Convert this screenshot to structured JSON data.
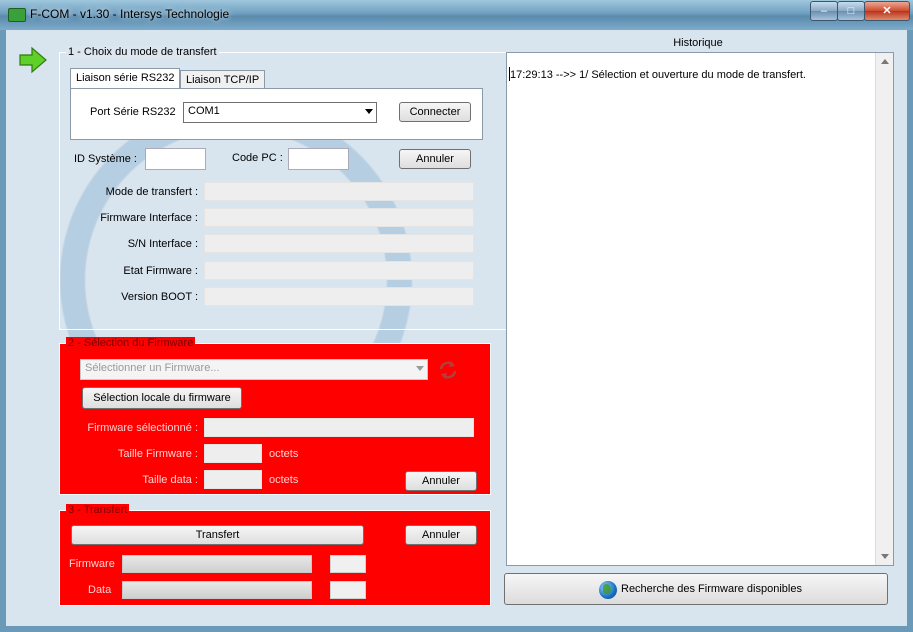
{
  "window": {
    "title": "F-COM - v1.30 - Intersys Technologie",
    "min_glyph": "–",
    "max_glyph": "□",
    "close_glyph": "✕"
  },
  "section1": {
    "legend": "1 - Choix du mode de transfert",
    "tabs": [
      {
        "label": "Liaison série RS232",
        "active": true
      },
      {
        "label": "Liaison TCP/IP",
        "active": false
      }
    ],
    "port_label": "Port Série RS232",
    "port_value": "COM1",
    "connect_button": "Connecter",
    "id_label": "ID Système :",
    "id_value": "",
    "code_label": "Code PC :",
    "code_value": "",
    "cancel_button": "Annuler",
    "fields": [
      {
        "label": "Mode de transfert :",
        "value": ""
      },
      {
        "label": "Firmware Interface :",
        "value": ""
      },
      {
        "label": "S/N Interface :",
        "value": ""
      },
      {
        "label": "Etat Firmware :",
        "value": ""
      },
      {
        "label": "Version BOOT :",
        "value": ""
      }
    ]
  },
  "section2": {
    "legend": "2 - Sélection du Firmware",
    "firmware_select_placeholder": "Sélectionner un Firmware...",
    "local_select_button": "Sélection locale du firmware",
    "selected_label": "Firmware sélectionné :",
    "selected_value": "",
    "size_label": "Taille Firmware :",
    "size_value": "",
    "size_unit": "octets",
    "data_size_label": "Taille data :",
    "data_size_value": "",
    "data_size_unit": "octets",
    "cancel_button": "Annuler"
  },
  "section3": {
    "legend": "3 - Transfert",
    "transfer_button": "Transfert",
    "cancel_button": "Annuler",
    "firmware_label": "Firmware",
    "firmware_progress": 0,
    "firmware_percent": "",
    "data_label": "Data",
    "data_progress": 0,
    "data_percent": ""
  },
  "history": {
    "title": "Historique",
    "lines": [
      "17:29:13 -->> 1/ Sélection et ouverture du mode de transfert."
    ]
  },
  "search_button": "Recherche des Firmware disponibles",
  "colors": {
    "section_red": "#ff0000",
    "arrow_green": "#5fd028"
  }
}
